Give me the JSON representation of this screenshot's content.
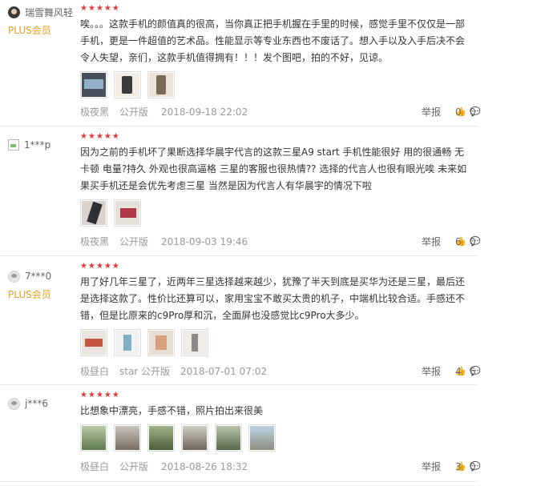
{
  "reviews": [
    {
      "username": "瑞雪舞风轻",
      "plus_label": "PLUS会员",
      "stars": 5,
      "text": "唉。。。这款手机的颜值真的很高，当你真正把手机握在手里的时候，感觉手里不仅仅是一部手机，更是一件超值的艺术品。性能显示等专业东西也不废话了。想入手以及入手后决不会令人失望，亲们，这款手机值得拥有！！！发个图吧，拍的不好，见谅。",
      "images": 3,
      "color": "极夜黑",
      "version": "公开版",
      "date": "2018-09-18 22:02",
      "report": "举报",
      "likes": "0",
      "replies": "0"
    },
    {
      "username": "1***p",
      "plus_label": "",
      "stars": 5,
      "text": "因为之前的手机坏了果断选择华晨宇代言的这款三星A9 start 手机性能很好 用的很通畅 无卡顿 电量?持久 外观也很高逼格 三星的客服也很热情?? 选择的代言人也很有眼光唉 未来如果买手机还是会优先考虑三星 当然是因为代言人有华晨宇的情况下啦",
      "images": 2,
      "color": "极夜黑",
      "version": "公开版",
      "date": "2018-09-03 19:46",
      "report": "举报",
      "likes": "6",
      "replies": "0"
    },
    {
      "username": "7***0",
      "plus_label": "PLUS会员",
      "stars": 5,
      "text": "用了好几年三星了，近两年三星选择越来越少，犹豫了半天到底是买华为还是三星，最后还是选择这款了。性价比还算可以，家用宝宝不敢买太贵的机子，中端机比较合适。手感还不错，但是比原来的c9Pro厚和沉，全面屏也没感觉比c9Pro大多少。",
      "images": 4,
      "color": "极昼白",
      "version": "star 公开版",
      "date": "2018-07-01 07:02",
      "report": "举报",
      "likes": "4",
      "replies": "6"
    },
    {
      "username": "j***6",
      "plus_label": "",
      "stars": 5,
      "text": "比想象中漂亮，手感不错，照片拍出来很美",
      "images": 6,
      "color": "极昼白",
      "version": "公开版",
      "date": "2018-08-26 18:32",
      "report": "举报",
      "likes": "3",
      "replies": "0"
    }
  ],
  "icons": {
    "like": "thumbs-up-icon",
    "reply": "comment-icon",
    "star": "star-icon"
  },
  "colors": {
    "star": "#e4393c",
    "plus": "#e3a024"
  }
}
